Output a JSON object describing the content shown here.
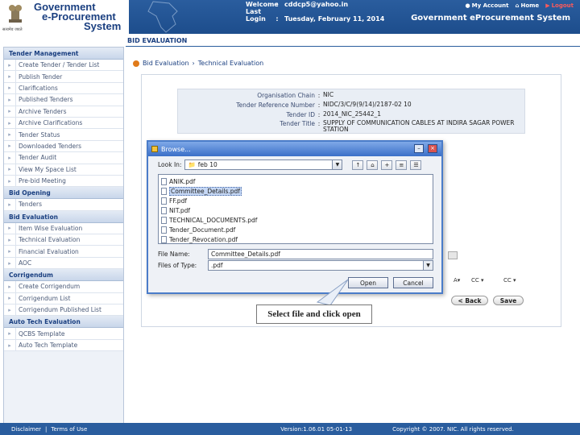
{
  "header": {
    "brand_line1": "Government",
    "brand_line2": "e-Procurement",
    "brand_line3": "System",
    "emblem_caption": "सत्यमेव जयते",
    "welcome_label": "Welcome",
    "welcome_value": "cddcp5@yahoo.in",
    "lastlogin_label": "Last Login",
    "lastlogin_value": "Tuesday, February 11, 2014",
    "colon": ":",
    "nav": {
      "account": "My Account",
      "home": "Home",
      "logout": "Logout"
    },
    "system_title": "Government eProcurement System"
  },
  "sidebar": {
    "sections": [
      {
        "title": "Tender Management",
        "items": [
          "Create Tender / Tender List",
          "Publish Tender",
          "Clarifications",
          "Published Tenders",
          "Archive Tenders",
          "Archive Clarifications",
          "Tender Status",
          "Downloaded Tenders",
          "Tender Audit",
          "View My Space List",
          "Pre-bid Meeting"
        ]
      },
      {
        "title": "Bid Opening",
        "items": [
          "Tenders"
        ]
      },
      {
        "title": "Bid Evaluation",
        "items": [
          "Item Wise Evaluation",
          "Technical Evaluation",
          "Financial Evaluation",
          "AOC"
        ]
      },
      {
        "title": "Corrigendum",
        "items": [
          "Create Corrigendum",
          "Corrigendum List",
          "Corrigendum Published List"
        ]
      },
      {
        "title": "Auto Tech Evaluation",
        "items": [
          "QCBS Template",
          "Auto Tech Template"
        ]
      }
    ]
  },
  "page": {
    "title": "BID EVALUATION",
    "breadcrumb": [
      "Bid Evaluation",
      "Technical Evaluation"
    ],
    "breadcrumb_sep": "›"
  },
  "tender_info": [
    {
      "label": "Organisation Chain",
      "value": "NIC"
    },
    {
      "label": "Tender Reference Number",
      "value": "NIDC/3/C/9(9/14)/2187-02 10"
    },
    {
      "label": "Tender ID",
      "value": "2014_NIC_25442_1"
    },
    {
      "label": "Tender Title",
      "value": "SUPPLY OF COMMUNICATION CABLES AT INDIRA SAGAR POWER STATION"
    }
  ],
  "right_controls": {
    "select1": "A▾",
    "select2": "CC ▾",
    "select3": "CC ▾",
    "back_label": "< Back",
    "save_label": "Save"
  },
  "dialog": {
    "title": "Browse...",
    "lookin_label": "Look In:",
    "lookin_value": "feb 10",
    "files": [
      "ANIK.pdf",
      "Committee_Details.pdf",
      "FF.pdf",
      "NIT.pdf",
      "TECHNICAL_DOCUMENTS.pdf",
      "Tender_Document.pdf",
      "Tender_Revocation.pdf"
    ],
    "selected_index": 1,
    "filename_label": "File Name:",
    "filename_value": "Committee_Details.pdf",
    "filetype_label": "Files of Type:",
    "filetype_value": ".pdf",
    "open_label": "Open",
    "cancel_label": "Cancel"
  },
  "callout": "Select file and click open",
  "footer": {
    "disclaimer": "Disclaimer",
    "sep": "|",
    "terms": "Terms of Use",
    "version": "Version:1.06.01 05-01-13",
    "copyright": "Copyright © 2007. NIC. All rights reserved."
  }
}
